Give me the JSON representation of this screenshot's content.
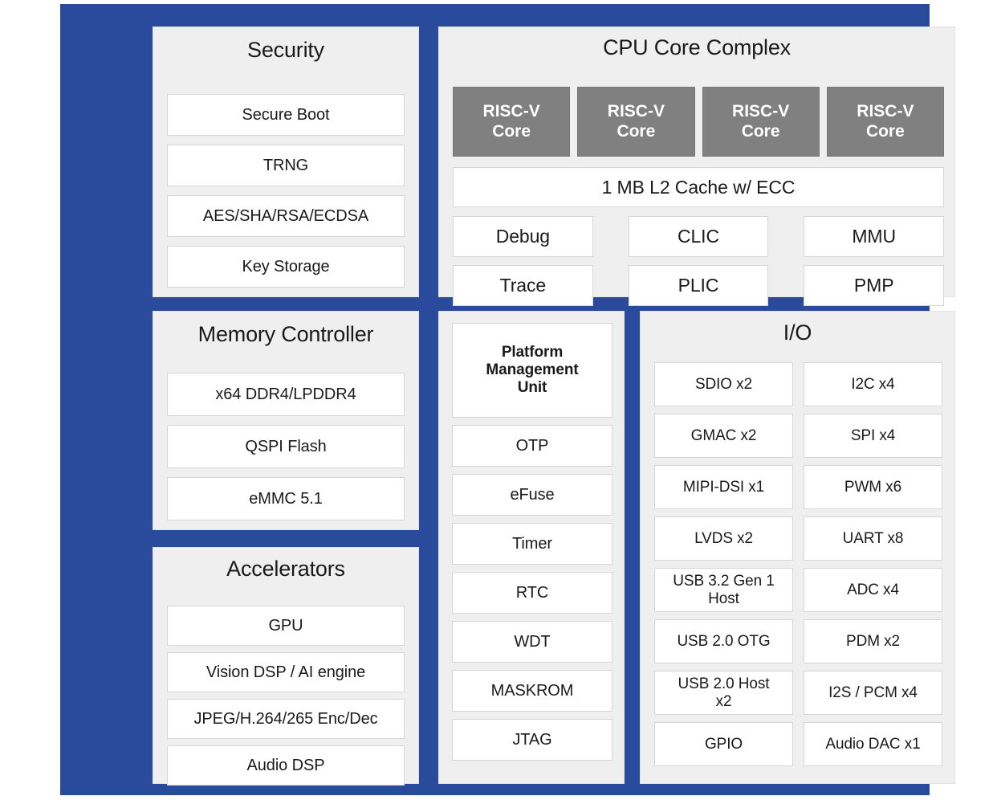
{
  "diagram": {
    "frame_color": "#2a4b9b",
    "panel_bg": "#efefef",
    "block_bg": "#ffffff",
    "core_bg": "#808080",
    "text_color": "#1a1a1a"
  },
  "security": {
    "title": "Security",
    "items": [
      "Secure Boot",
      "TRNG",
      "AES/SHA/RSA/ECDSA",
      "Key Storage"
    ]
  },
  "cpu": {
    "title": "CPU Core Complex",
    "cores": [
      "RISC-V\nCore",
      "RISC-V\nCore",
      "RISC-V\nCore",
      "RISC-V\nCore"
    ],
    "cache": "1 MB L2 Cache w/ ECC",
    "blocks": [
      "Debug",
      "CLIC",
      "MMU",
      "Trace",
      "PLIC",
      "PMP"
    ]
  },
  "memory": {
    "title": "Memory Controller",
    "items": [
      "x64 DDR4/LPDDR4",
      "QSPI Flash",
      "eMMC 5.1"
    ]
  },
  "accelerators": {
    "title": "Accelerators",
    "items": [
      "GPU",
      "Vision DSP / AI engine",
      "JPEG/H.264/265 Enc/Dec",
      "Audio DSP"
    ]
  },
  "pmu": {
    "items": [
      "Platform\nManagement\nUnit",
      "OTP",
      "eFuse",
      "Timer",
      "RTC",
      "WDT",
      "MASKROM",
      "JTAG"
    ]
  },
  "io": {
    "title": "I/O",
    "items": [
      "SDIO x2",
      "I2C x4",
      "GMAC x2",
      "SPI x4",
      "MIPI-DSI x1",
      "PWM x6",
      "LVDS x2",
      "UART x8",
      "USB 3.2 Gen 1\nHost",
      "ADC x4",
      "USB 2.0 OTG",
      "PDM x2",
      "USB 2.0 Host\nx2",
      "I2S / PCM x4",
      "GPIO",
      "Audio DAC x1"
    ]
  }
}
